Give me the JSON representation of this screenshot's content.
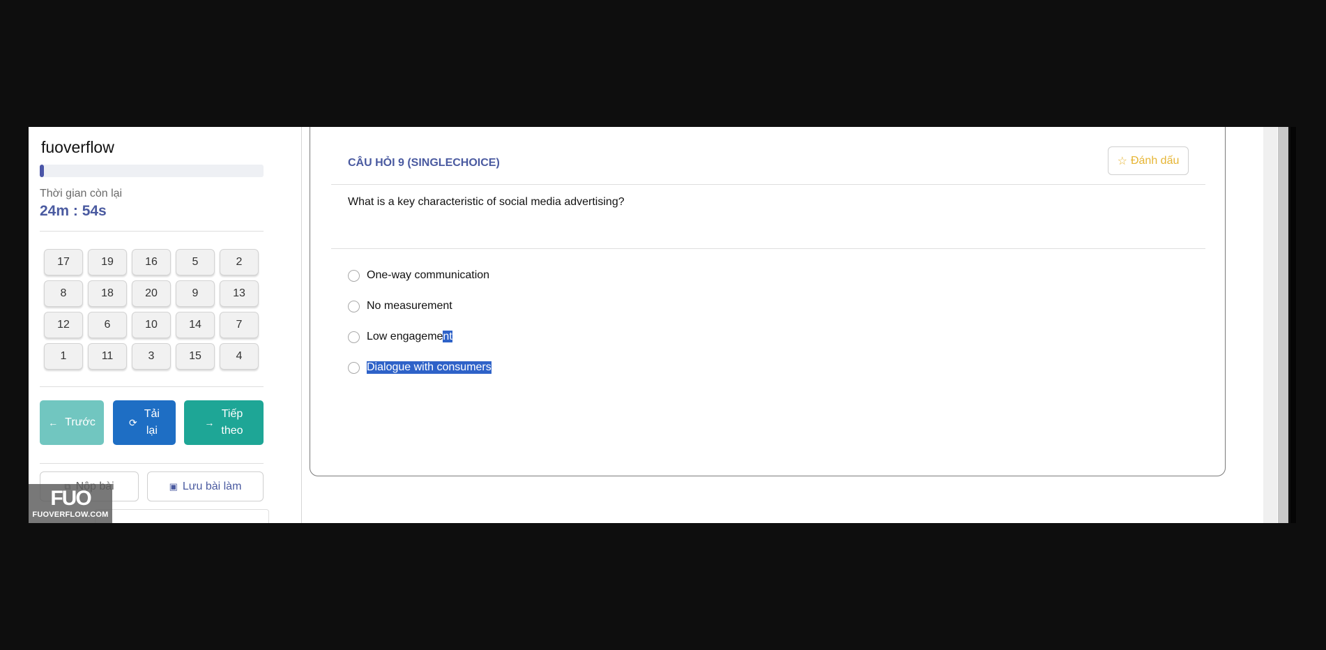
{
  "sidebar": {
    "brand": "fuoverflow",
    "progress": 0.02,
    "time_label": "Thời gian còn lại",
    "time_value": "24m : 54s",
    "question_numbers": [
      "17",
      "19",
      "16",
      "5",
      "2",
      "8",
      "18",
      "20",
      "9",
      "13",
      "12",
      "6",
      "10",
      "14",
      "7",
      "1",
      "11",
      "3",
      "15",
      "4"
    ],
    "buttons": {
      "prev": "Trước",
      "reload_line1": "Tải",
      "reload_line2": "lại",
      "next_line1": "Tiếp",
      "next_line2": "theo",
      "submit": "Nộp bài",
      "save": "Lưu bài làm"
    },
    "logo_mark": "FUO",
    "logo_text": "FUOVERFLOW.COM"
  },
  "question": {
    "title": "CÂU HỎI 9 (SINGLECHOICE)",
    "bookmark_label": "Đánh dấu",
    "text": "What is a key characteristic of social media advertising?",
    "options": {
      "a": "One-way communication",
      "b": "No measurement",
      "c_plain": "Low engageme",
      "c_selected": "nt",
      "d": "Dialogue with consumers"
    }
  },
  "colors": {
    "accent": "#4a5aa0",
    "prev": "#71c6c0",
    "reload": "#1e6ec4",
    "next": "#1ea696",
    "bookmark": "#e6b534",
    "selection": "#2e62c8"
  },
  "icons": {
    "prev": "arrow-left-icon",
    "reload": "refresh-icon",
    "next": "arrow-right-icon",
    "submit": "submit-icon",
    "save": "save-icon",
    "bookmark": "star-icon"
  }
}
